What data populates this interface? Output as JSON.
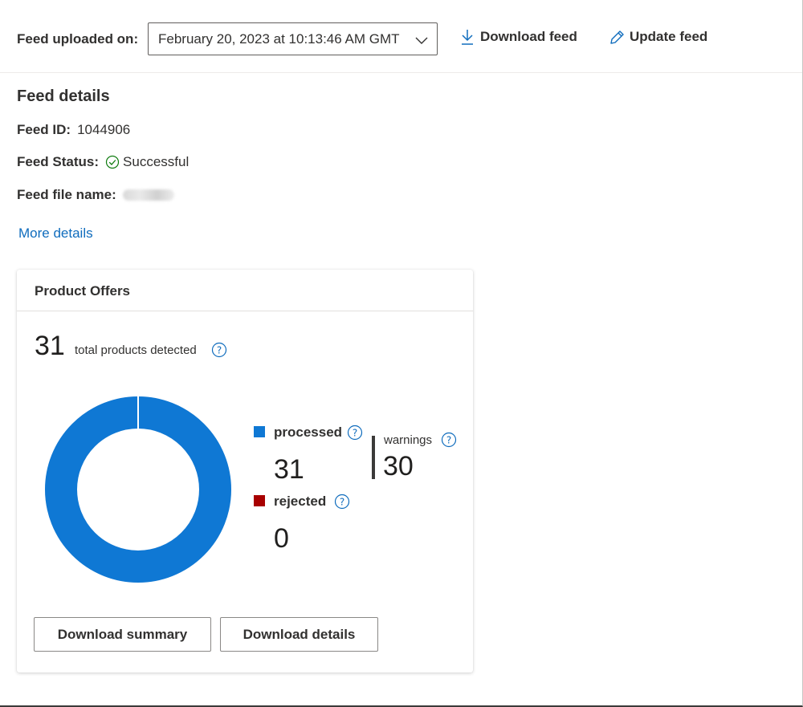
{
  "header": {
    "uploaded_label": "Feed uploaded on:",
    "upload_date": "February 20, 2023 at 10:13:46 AM GMT",
    "download_feed": "Download feed",
    "update_feed": "Update feed"
  },
  "details": {
    "title": "Feed details",
    "feed_id_label": "Feed ID:",
    "feed_id": "1044906",
    "status_label": "Feed Status:",
    "status": "Successful",
    "file_name_label": "Feed file name:",
    "more_details": "More details"
  },
  "offers": {
    "title": "Product Offers",
    "total": "31",
    "total_label": "total products detected",
    "processed_label": "processed",
    "processed": "31",
    "rejected_label": "rejected",
    "rejected": "0",
    "warnings_label": "warnings",
    "warnings": "30",
    "download_summary": "Download summary",
    "download_details": "Download details"
  },
  "colors": {
    "processed": "#0f78d4",
    "rejected": "#a80000",
    "link": "#0f6cbd",
    "success": "#107c10"
  },
  "chart_data": {
    "type": "pie",
    "categories": [
      "processed",
      "rejected"
    ],
    "values": [
      31,
      0
    ]
  }
}
